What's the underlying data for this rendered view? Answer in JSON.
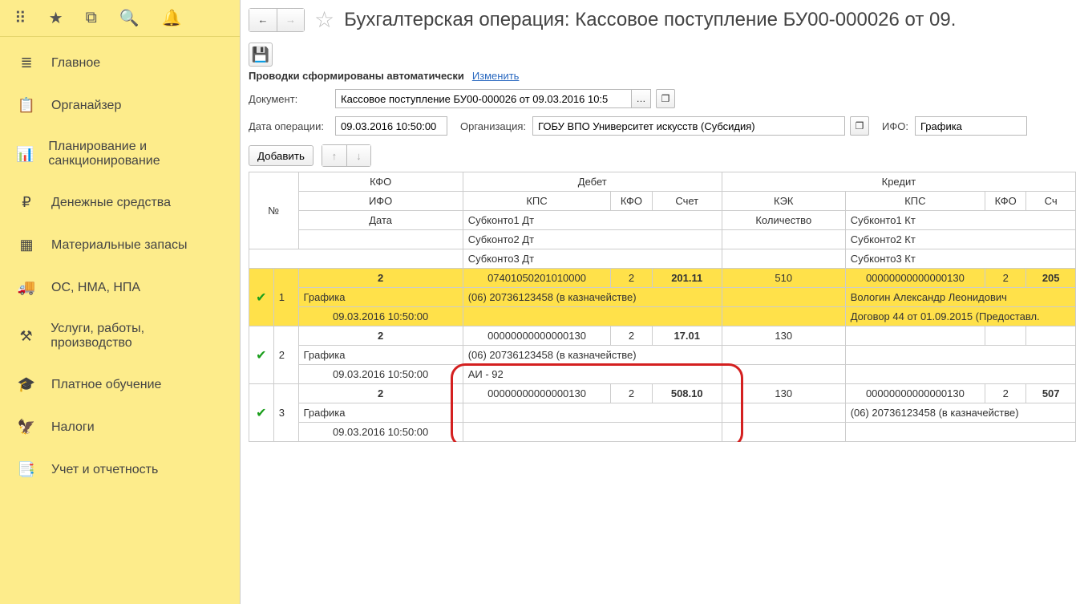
{
  "sidebar": {
    "items": [
      {
        "icon": "≣",
        "label": "Главное"
      },
      {
        "icon": "📋",
        "label": "Органайзер"
      },
      {
        "icon": "📊",
        "label": "Планирование и санкционирование"
      },
      {
        "icon": "₽",
        "label": "Денежные средства"
      },
      {
        "icon": "▦",
        "label": "Материальные запасы"
      },
      {
        "icon": "🚚",
        "label": "ОС, НМА, НПА"
      },
      {
        "icon": "⚒",
        "label": "Услуги, работы, производство"
      },
      {
        "icon": "🎓",
        "label": "Платное обучение"
      },
      {
        "icon": "🦅",
        "label": "Налоги"
      },
      {
        "icon": "📑",
        "label": "Учет и отчетность"
      }
    ]
  },
  "header": {
    "title": "Бухгалтерская операция: Кассовое поступление БУ00-000026 от 09.",
    "auto_text": "Проводки сформированы автоматически",
    "edit_link": "Изменить",
    "doc_label": "Документ:",
    "doc_value": "Кассовое поступление БУ00-000026 от 09.03.2016 10:5",
    "date_label": "Дата операции:",
    "date_value": "09.03.2016 10:50:00",
    "org_label": "Организация:",
    "org_value": "ГОБУ ВПО Университет искусств (Субсидия)",
    "ifo_label": "ИФО:",
    "ifo_value": "Графика",
    "add_btn": "Добавить"
  },
  "columns": {
    "n": "№",
    "kfo": "КФО",
    "debet": "Дебет",
    "kredit": "Кредит",
    "ifo": "ИФО",
    "kps": "КПС",
    "kfo2": "КФО",
    "sch": "Счет",
    "kek": "КЭК",
    "sch2": "Сч",
    "date": "Дата",
    "s1d": "Субконто1 Дт",
    "kol": "Количество",
    "s1k": "Субконто1 Кт",
    "s2d": "Субконто2 Дт",
    "s2k": "Субконто2 Кт",
    "s3d": "Субконто3 Дт",
    "s3k": "Субконто3 Кт"
  },
  "rows": [
    {
      "idx": "1",
      "kfo": "2",
      "kps": "07401050201010000",
      "kfo2": "2",
      "sch": "201.11",
      "kek": "510",
      "kps2": "00000000000000130",
      "kfo3": "2",
      "sch2": "205",
      "ifo": "Графика",
      "s1d": "(06) 20736123458 (в казначействе)",
      "s1k": "Вологин Александр Леонидович",
      "date": "09.03.2016 10:50:00",
      "s2d": "",
      "s2k": "Договор 44 от 01.09.2015 (Предоставл.",
      "s3d": "",
      "selected": true
    },
    {
      "idx": "2",
      "kfo": "2",
      "kps": "00000000000000130",
      "kfo2": "2",
      "sch": "17.01",
      "kek": "130",
      "kps2": "",
      "kfo3": "",
      "sch2": "",
      "ifo": "Графика",
      "s1d": "(06) 20736123458 (в казначействе)",
      "s1k": "",
      "date": "09.03.2016 10:50:00",
      "s2d": "АИ - 92",
      "s2k": "",
      "s3d": "",
      "selected": false
    },
    {
      "idx": "3",
      "kfo": "2",
      "kps": "00000000000000130",
      "kfo2": "2",
      "sch": "508.10",
      "kek": "130",
      "kps2": "00000000000000130",
      "kfo3": "2",
      "sch2": "507",
      "ifo": "Графика",
      "s1d": "",
      "s1k": "(06) 20736123458 (в казначействе)",
      "date": "09.03.2016 10:50:00",
      "s2d": "",
      "s2k": "",
      "s3d": "",
      "selected": false
    }
  ]
}
